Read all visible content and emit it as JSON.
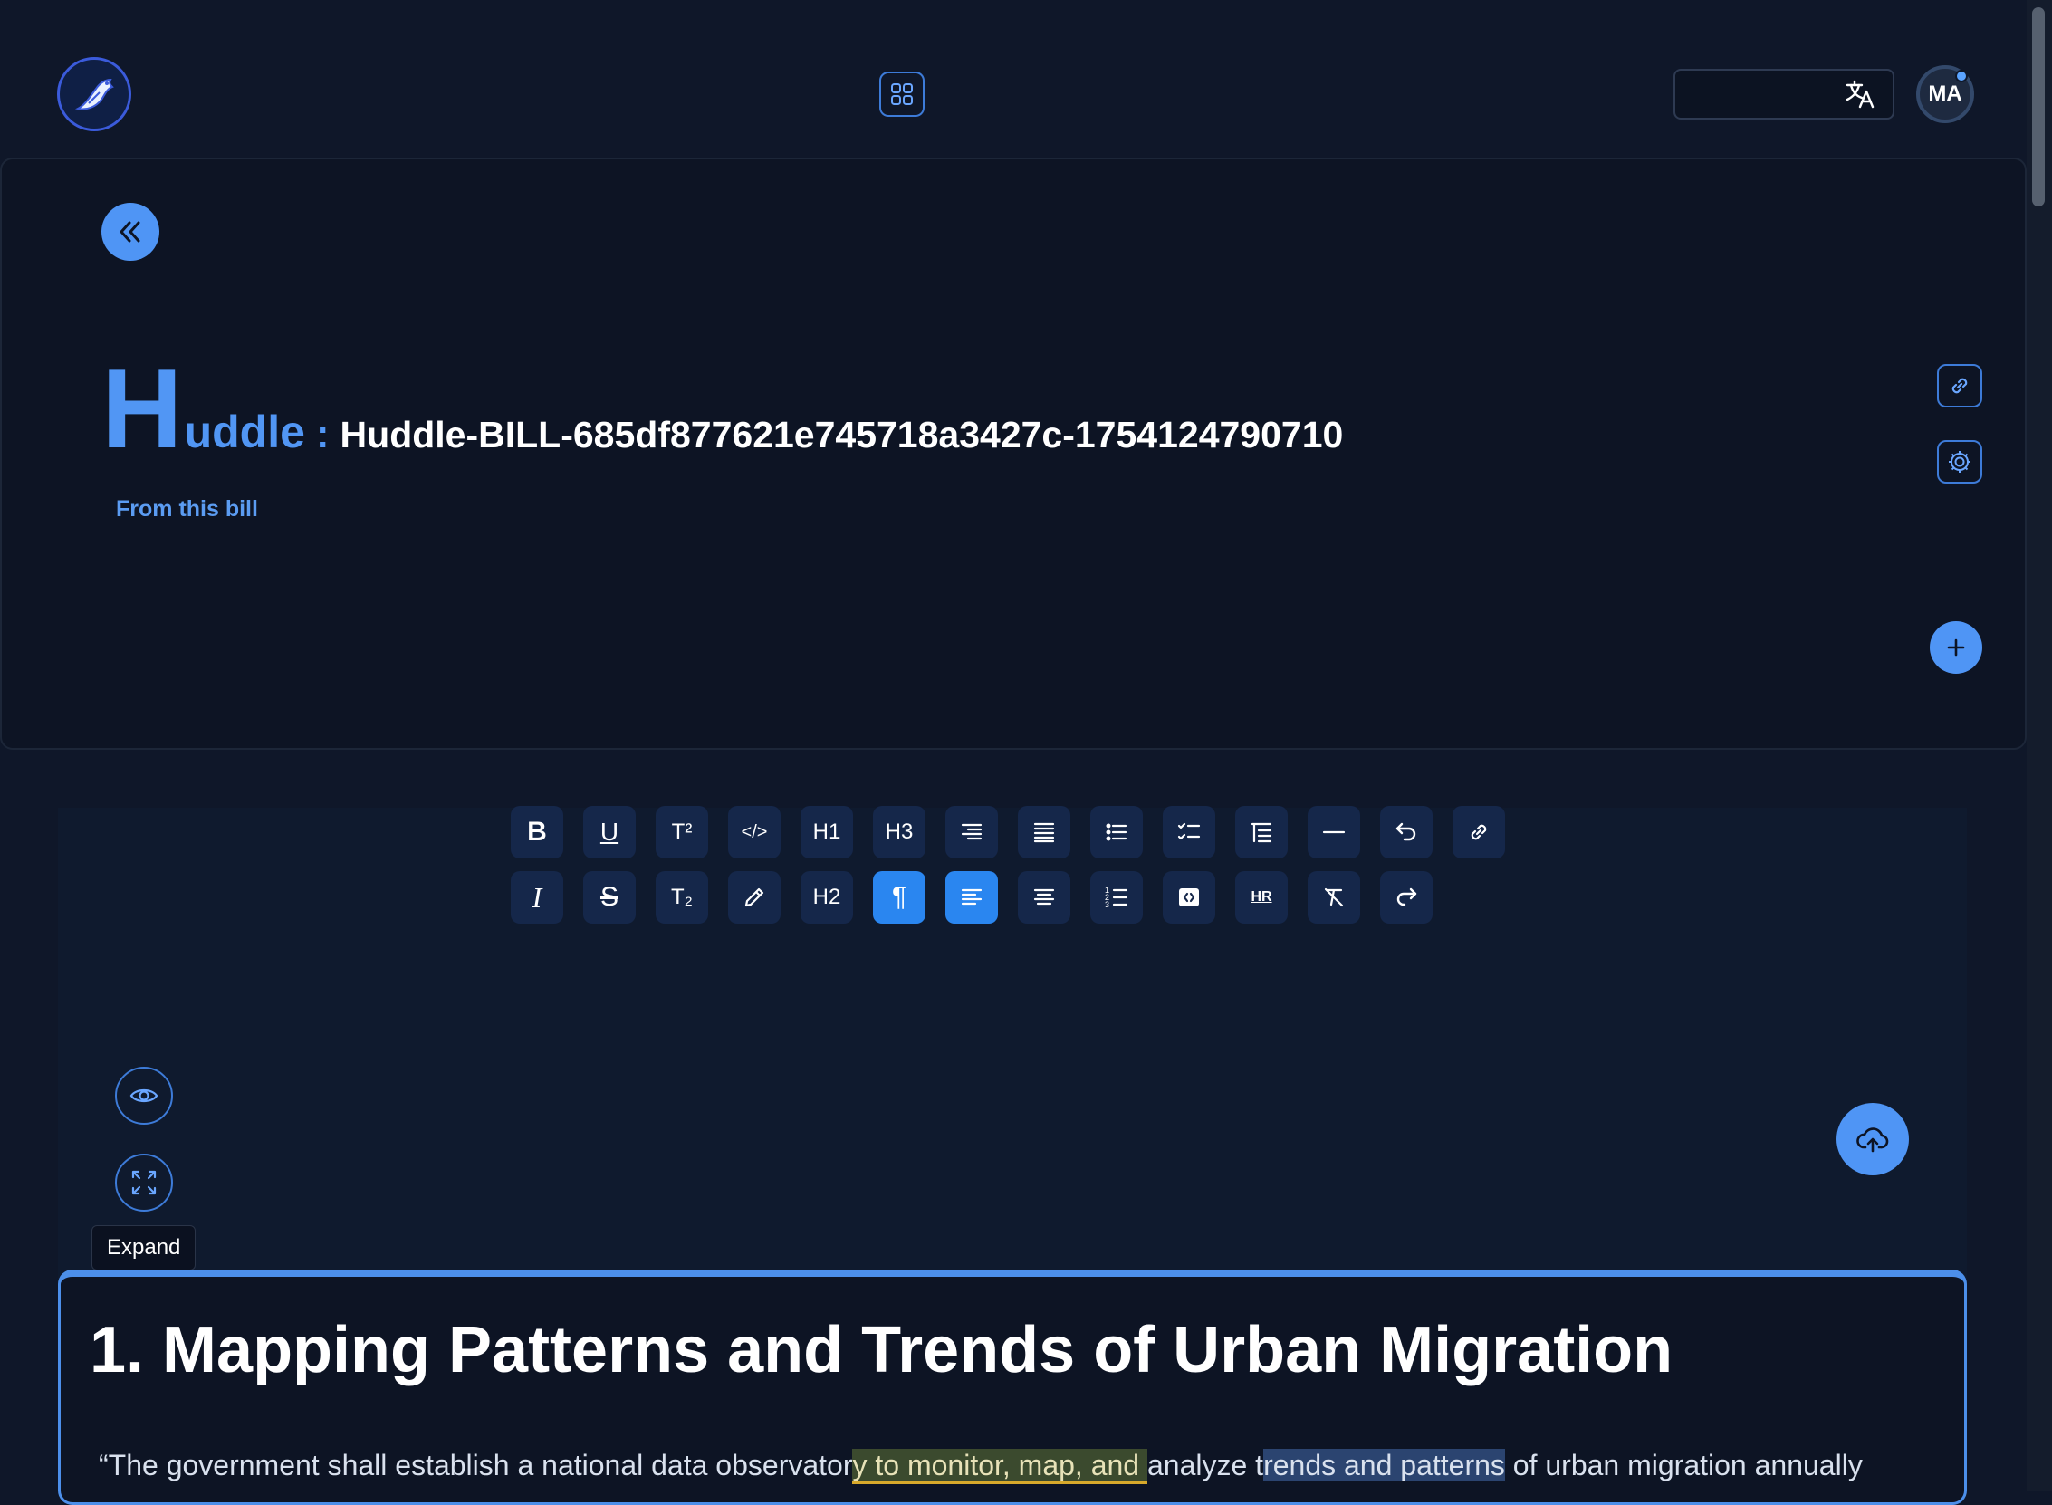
{
  "topbar": {
    "logo_icon": "bird-logo-icon",
    "apps_icon": "apps-grid-icon",
    "translate_icon": "translate-icon",
    "avatar_initials": "MA"
  },
  "header": {
    "title_initial": "H",
    "title_rest": "uddle",
    "title_separator": ":",
    "title_id": "Huddle-BILL-685df877621e745718a3427c-1754124790710",
    "subtitle": "From this bill"
  },
  "toolbar": {
    "row1": [
      {
        "name": "bold",
        "label": "B",
        "icon": "bold-icon"
      },
      {
        "name": "underline",
        "label": "U",
        "icon": "underline-icon"
      },
      {
        "name": "superscript",
        "label": "T²",
        "icon": "superscript-icon"
      },
      {
        "name": "code",
        "label": "</>",
        "icon": "code-icon"
      },
      {
        "name": "heading-1",
        "label": "H1",
        "icon": "heading-1-icon"
      },
      {
        "name": "heading-3",
        "label": "H3",
        "icon": "heading-3-icon"
      },
      {
        "name": "align-right",
        "label": "",
        "icon": "align-right-icon"
      },
      {
        "name": "align-justify",
        "label": "",
        "icon": "align-justify-icon"
      },
      {
        "name": "bullet-list",
        "label": "",
        "icon": "bullet-list-icon"
      },
      {
        "name": "task-list",
        "label": "",
        "icon": "task-list-icon"
      },
      {
        "name": "indent",
        "label": "",
        "icon": "indent-icon"
      },
      {
        "name": "horizontal-line",
        "label": "",
        "icon": "horizontal-line-icon"
      },
      {
        "name": "undo",
        "label": "",
        "icon": "undo-icon"
      },
      {
        "name": "link",
        "label": "",
        "icon": "link-icon"
      }
    ],
    "row2": [
      {
        "name": "italic",
        "label": "I",
        "icon": "italic-icon"
      },
      {
        "name": "strikethrough",
        "label": "S",
        "icon": "strikethrough-icon"
      },
      {
        "name": "subscript",
        "label": "T₂",
        "icon": "subscript-icon"
      },
      {
        "name": "highlight",
        "label": "",
        "icon": "pencil-icon"
      },
      {
        "name": "heading-2",
        "label": "H2",
        "icon": "heading-2-icon"
      },
      {
        "name": "paragraph",
        "label": "¶",
        "icon": "paragraph-icon",
        "active": true
      },
      {
        "name": "align-left",
        "label": "",
        "icon": "align-left-icon",
        "active": true
      },
      {
        "name": "align-center",
        "label": "",
        "icon": "align-center-icon"
      },
      {
        "name": "ordered-list",
        "label": "",
        "icon": "ordered-list-icon"
      },
      {
        "name": "code-block",
        "label": "",
        "icon": "code-block-icon"
      },
      {
        "name": "hr",
        "label": "HR",
        "icon": "hr-icon"
      },
      {
        "name": "clear-format",
        "label": "",
        "icon": "clear-format-icon"
      },
      {
        "name": "redo",
        "label": "",
        "icon": "redo-icon"
      }
    ]
  },
  "editor": {
    "tooltip": "Expand",
    "heading": "1. Mapping Patterns and Trends of Urban Migration",
    "para_part1": "“The government shall establish a national data observator",
    "para_highlight1": "y to monitor, map, and ",
    "para_part2": "analyze t",
    "para_highlight2": "rends and patterns",
    "para_part3": " of urban migration annually"
  },
  "colors": {
    "background": "#0f1729",
    "accent": "#4f95f5",
    "active_tool": "#2a86f0"
  }
}
